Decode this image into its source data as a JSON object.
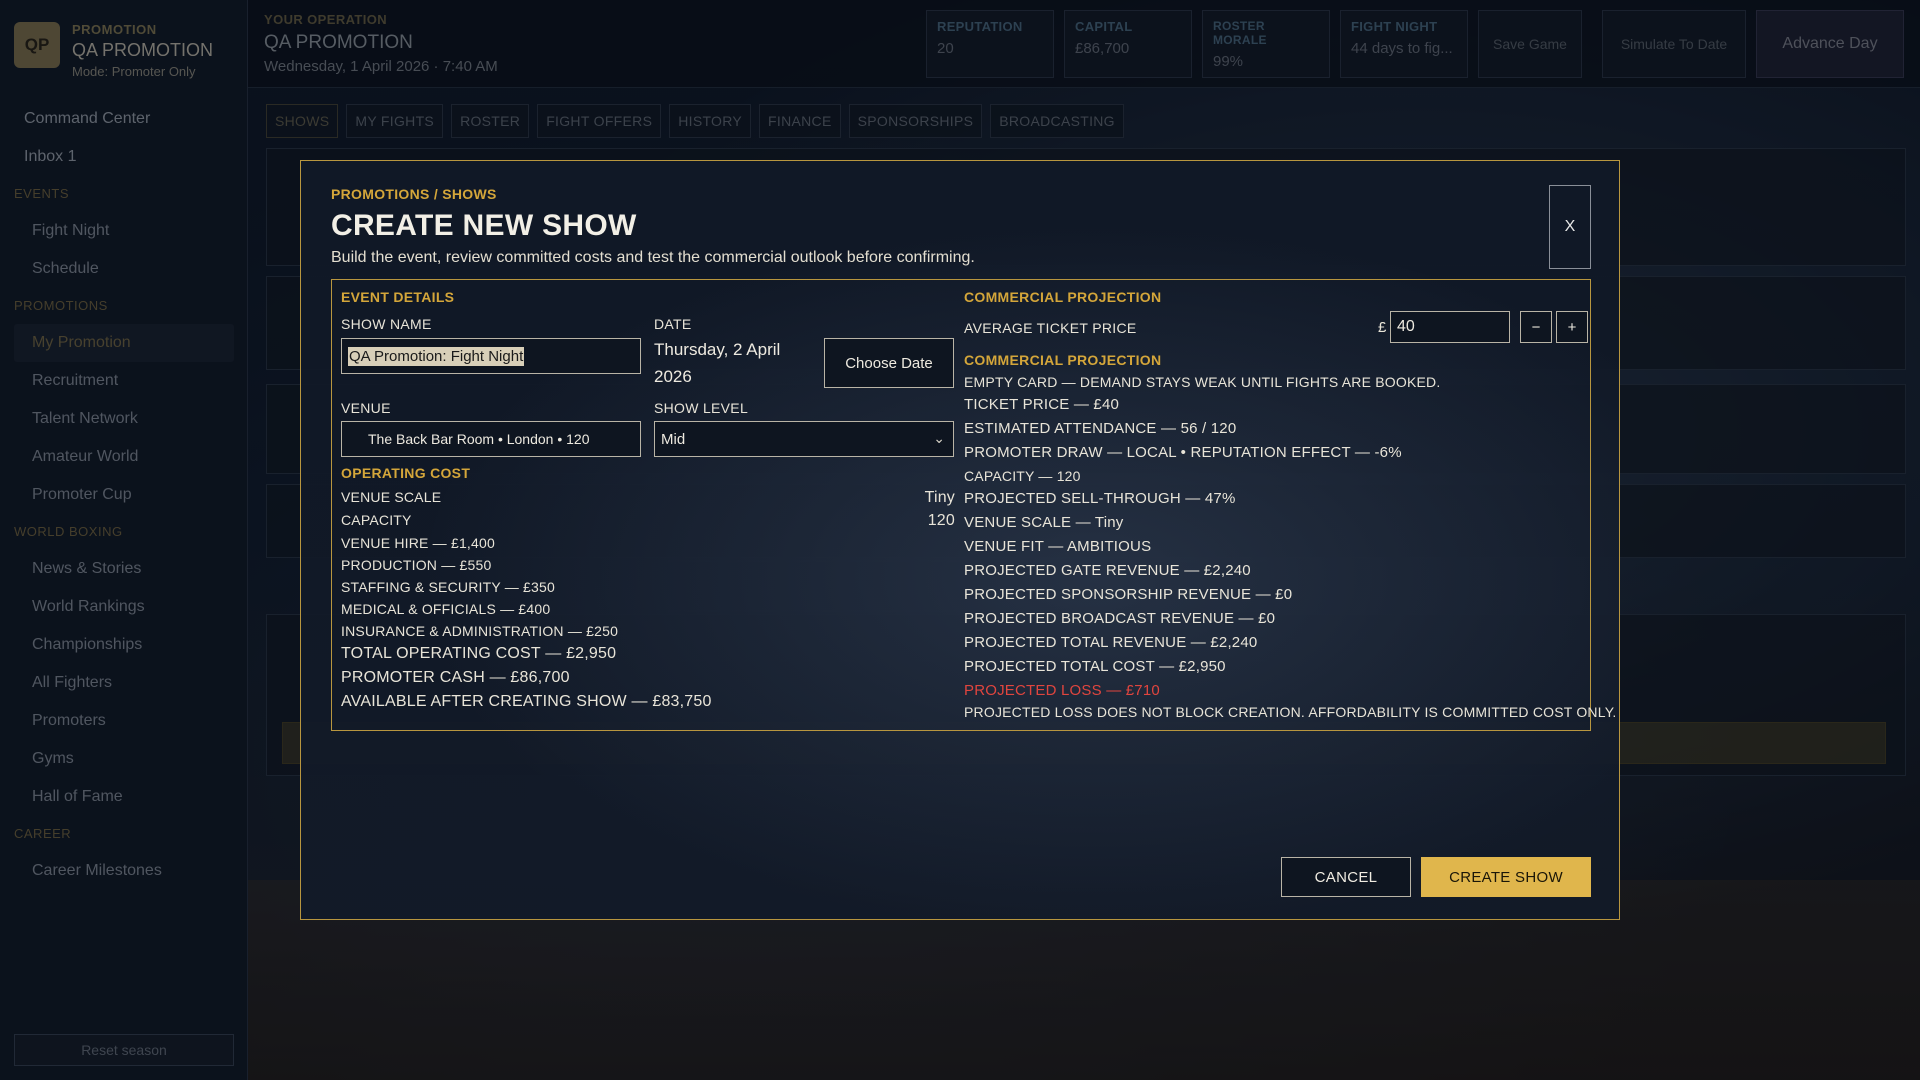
{
  "brand": {
    "logo": "QP",
    "kicker": "PROMOTION",
    "name": "QA PROMOTION",
    "mode": "Mode: Promoter Only"
  },
  "sidebar": {
    "top_items": [
      "Command Center",
      "Inbox 1"
    ],
    "sections": [
      {
        "title": "EVENTS",
        "items": [
          "Fight Night",
          "Schedule"
        ]
      },
      {
        "title": "PROMOTIONS",
        "items": [
          "My Promotion",
          "Recruitment",
          "Talent Network",
          "Amateur World",
          "Promoter Cup"
        ]
      },
      {
        "title": "WORLD BOXING",
        "items": [
          "News & Stories",
          "World Rankings",
          "Championships",
          "All Fighters",
          "Promoters",
          "Gyms",
          "Hall of Fame"
        ]
      },
      {
        "title": "CAREER",
        "items": [
          "Career Milestones"
        ]
      }
    ],
    "active_item": "My Promotion",
    "reset_label": "Reset season"
  },
  "header": {
    "kicker": "YOUR OPERATION",
    "name": "QA PROMOTION",
    "date": "Wednesday, 1 April 2026 · 7:40 AM",
    "stats": [
      {
        "label": "REPUTATION",
        "value": "20"
      },
      {
        "label": "CAPITAL",
        "value": "£86,700"
      },
      {
        "label": "ROSTER MORALE",
        "value": "99%"
      },
      {
        "label": "FIGHT NIGHT",
        "value": "44 days to fig..."
      }
    ],
    "save_label": "Save Game",
    "simulate_label": "Simulate To Date",
    "advance_label": "Advance Day"
  },
  "tabs": [
    "SHOWS",
    "MY FIGHTS",
    "ROSTER",
    "FIGHT OFFERS",
    "HISTORY",
    "FINANCE",
    "SPONSORSHIPS",
    "BROADCASTING"
  ],
  "active_tab": "SHOWS",
  "modal": {
    "breadcrumb": "PROMOTIONS / SHOWS",
    "title": "CREATE NEW SHOW",
    "subtitle": "Build the event, review committed costs and test the commercial outlook before confirming.",
    "close_label": "X",
    "event_details": {
      "heading": "EVENT DETAILS",
      "show_name_label": "SHOW NAME",
      "show_name_value": "QA Promotion: Fight Night",
      "date_label": "DATE",
      "date_value": "Thursday, 2 April 2026",
      "choose_date_label": "Choose Date",
      "venue_label": "VENUE",
      "venue_value": "The Back Bar Room • London • 120",
      "show_level_label": "SHOW LEVEL",
      "show_level_value": "Mid"
    },
    "operating_cost": {
      "heading": "OPERATING COST",
      "venue_scale_label": "VENUE SCALE",
      "venue_scale_value": "Tiny",
      "capacity_label": "CAPACITY",
      "capacity_value": "120",
      "lines": [
        "VENUE HIRE — £1,400",
        "PRODUCTION — £550",
        "STAFFING & SECURITY — £350",
        "MEDICAL & OFFICIALS — £400",
        "INSURANCE & ADMINISTRATION — £250"
      ],
      "totals": [
        "TOTAL OPERATING COST — £2,950",
        "PROMOTER CASH — £86,700",
        "AVAILABLE AFTER CREATING SHOW — £83,750"
      ]
    },
    "projection": {
      "heading": "COMMERCIAL PROJECTION",
      "ticket_price_label": "AVERAGE TICKET PRICE",
      "currency": "£",
      "ticket_price_value": "40",
      "minus_label": "−",
      "plus_label": "+",
      "sub_heading": "COMMERCIAL PROJECTION",
      "note": "EMPTY CARD — DEMAND STAYS WEAK UNTIL FIGHTS ARE BOOKED.",
      "ticket_price": "TICKET PRICE — £40",
      "attendance": "ESTIMATED ATTENDANCE — 56 / 120",
      "draw": "PROMOTER DRAW — LOCAL • REPUTATION EFFECT — -6%",
      "capacity": "CAPACITY — 120",
      "sell_through": "PROJECTED SELL-THROUGH — 47%",
      "venue_scale": "VENUE SCALE — Tiny",
      "venue_fit": "VENUE FIT — AMBITIOUS",
      "gate_revenue": "PROJECTED GATE REVENUE — £2,240",
      "sponsorship_revenue": "PROJECTED SPONSORSHIP REVENUE — £0",
      "broadcast_revenue": "PROJECTED BROADCAST REVENUE — £0",
      "total_revenue": "PROJECTED TOTAL REVENUE — £2,240",
      "total_cost": "PROJECTED TOTAL COST — £2,950",
      "loss": "PROJECTED LOSS — £710",
      "footnote": "PROJECTED LOSS DOES NOT BLOCK CREATION. AFFORDABILITY IS COMMITTED COST ONLY."
    },
    "cancel_label": "CANCEL",
    "create_label": "CREATE SHOW"
  },
  "colors": {
    "accent": "#d4a63a",
    "loss": "#e0453e",
    "primary_button": "#e0b64c"
  }
}
